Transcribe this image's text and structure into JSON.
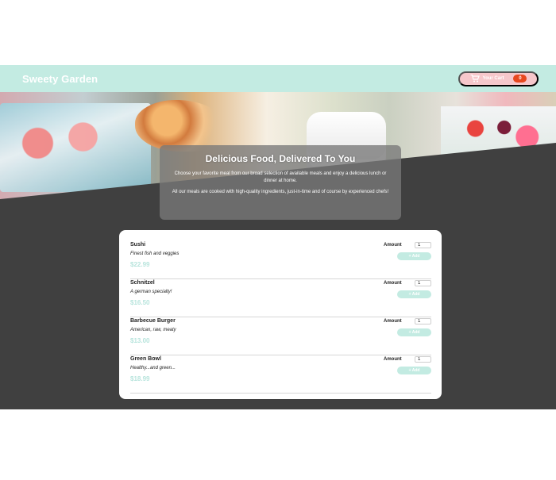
{
  "app": {
    "brand": "Sweety Garden"
  },
  "cart": {
    "label": "Your Cart",
    "count": "0",
    "icon": "cart-icon"
  },
  "intro": {
    "title": "Delicious Food, Delivered To You",
    "paragraph_1": "Choose your favorite meal from our broad selection of available meals and enjoy a delicious lunch or dinner at home.",
    "paragraph_2": "All our meals are cooked with high-quality ingredients, just-in-time and of course by experienced chefs!"
  },
  "meals": [
    {
      "name": "Sushi",
      "description": "Finest fish and veggies",
      "price": "$22.99",
      "amount_label": "Amount",
      "amount_value": "1",
      "add_label": "+ Add"
    },
    {
      "name": "Schnitzel",
      "description": "A german specialty!",
      "price": "$16.50",
      "amount_label": "Amount",
      "amount_value": "1",
      "add_label": "+ Add"
    },
    {
      "name": "Barbecue Burger",
      "description": "American, raw, meaty",
      "price": "$13.00",
      "amount_label": "Amount",
      "amount_value": "1",
      "add_label": "+ Add"
    },
    {
      "name": "Green Bowl",
      "description": "Healthy...and green...",
      "price": "$18.99",
      "amount_label": "Amount",
      "amount_value": "1",
      "add_label": "+ Add"
    }
  ],
  "colors": {
    "header_background": "#c3ebe2",
    "cart_button": "#f6c7cb",
    "cart_badge": "#e7481f",
    "page_background": "#404040",
    "price": "#b7e4dc"
  }
}
